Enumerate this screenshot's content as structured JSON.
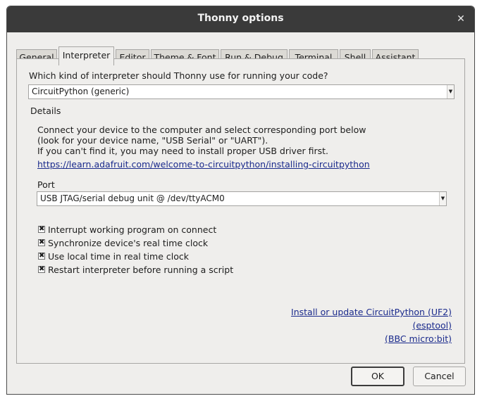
{
  "window": {
    "title": "Thonny options"
  },
  "tabs": [
    "General",
    "Interpreter",
    "Editor",
    "Theme & Font",
    "Run & Debug",
    "Terminal",
    "Shell",
    "Assistant"
  ],
  "active_tab": "Interpreter",
  "interpreter": {
    "question": "Which kind of interpreter should Thonny use for running your code?",
    "selected": "CircuitPython (generic)",
    "details_label": "Details",
    "description": [
      "Connect your device to the computer and select corresponding port below",
      "(look for your device name, \"USB Serial\" or \"UART\").",
      "If you can't find it, you may need to install proper USB driver first."
    ],
    "help_link": "https://learn.adafruit.com/welcome-to-circuitpython/installing-circuitpython",
    "port_label": "Port",
    "port_selected": "USB JTAG/serial debug unit @ /dev/ttyACM0",
    "options": [
      {
        "label": "Interrupt working program on connect",
        "checked": true
      },
      {
        "label": "Synchronize device's real time clock",
        "checked": true
      },
      {
        "label": "Use local time in real time clock",
        "checked": true
      },
      {
        "label": "Restart interpreter before running a script",
        "checked": true
      }
    ],
    "install_links": [
      "Install or update CircuitPython (UF2)",
      "(esptool)",
      "(BBC micro:bit)"
    ]
  },
  "buttons": {
    "ok": "OK",
    "cancel": "Cancel"
  },
  "check_mark": "✖",
  "icons": {
    "close": "close-icon",
    "dropdown": "dropdown-arrow-icon"
  }
}
